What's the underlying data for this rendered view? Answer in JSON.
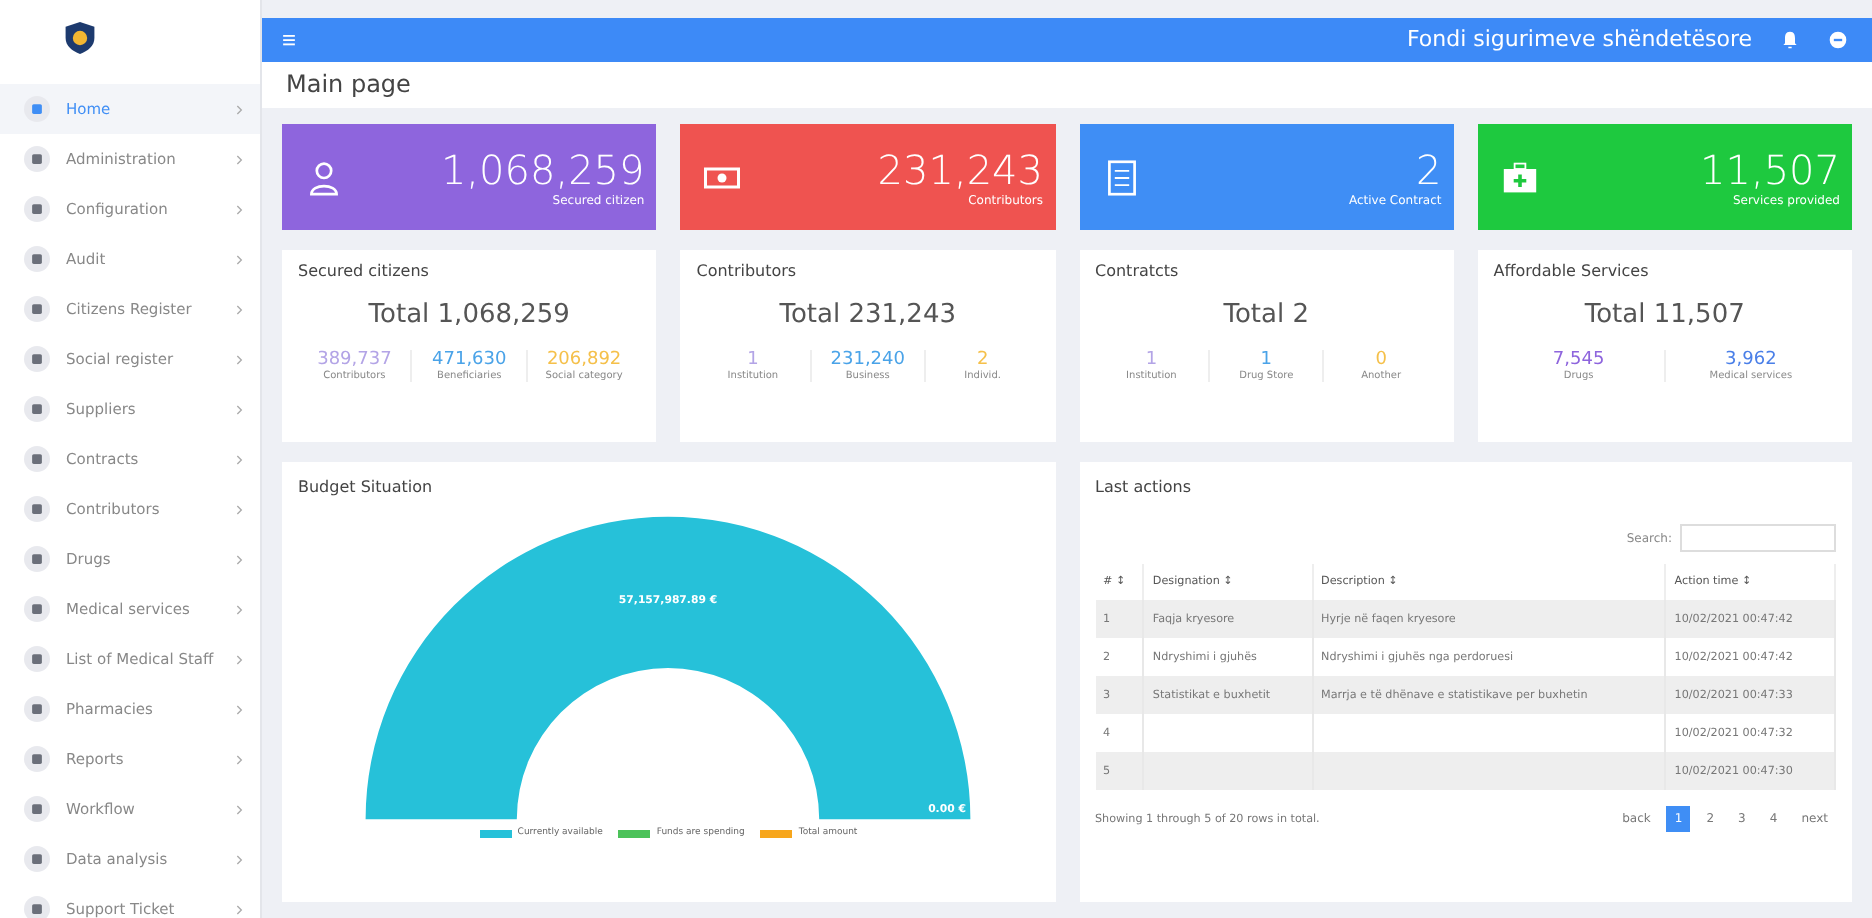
{
  "topbar": {
    "menu_glyph": "≡",
    "title": "Fondi sigurimeve shëndetësore"
  },
  "sidebar": {
    "items": [
      {
        "label": "Home",
        "selected": true
      },
      {
        "label": "Administration",
        "selected": false
      },
      {
        "label": "Configuration",
        "selected": false
      },
      {
        "label": "Audit",
        "selected": false
      },
      {
        "label": "Citizens Register",
        "selected": false
      },
      {
        "label": "Social register",
        "selected": false
      },
      {
        "label": "Suppliers",
        "selected": false
      },
      {
        "label": "Contracts",
        "selected": false
      },
      {
        "label": "Contributors",
        "selected": false
      },
      {
        "label": "Drugs",
        "selected": false
      },
      {
        "label": "Medical services",
        "selected": false
      },
      {
        "label": "List of Medical Staff",
        "selected": false
      },
      {
        "label": "Pharmacies",
        "selected": false
      },
      {
        "label": "Reports",
        "selected": false
      },
      {
        "label": "Workflow",
        "selected": false
      },
      {
        "label": "Data analysis",
        "selected": false
      },
      {
        "label": "Support Ticket",
        "selected": false
      }
    ]
  },
  "page_title": "Main page",
  "summary_cards": [
    {
      "kind": "person",
      "value": "1,068,259",
      "label": "Secured citizen",
      "color": "#8e65dd"
    },
    {
      "kind": "money",
      "value": "231,243",
      "label": "Contributors",
      "color": "#ef5350"
    },
    {
      "kind": "document",
      "value": "2",
      "label": "Active Contract",
      "color": "#3f8ef5"
    },
    {
      "kind": "medkit",
      "value": "11,507",
      "label": "Services provided",
      "color": "#1ec93f"
    }
  ],
  "stat_cards": [
    {
      "title": "Secured citizens",
      "total": "Total 1,068,259",
      "items": [
        {
          "value": "389,737",
          "label": "Contributors",
          "color": "#b3a4e6"
        },
        {
          "value": "471,630",
          "label": "Beneficiaries",
          "color": "#4aa3e8"
        },
        {
          "value": "206,892",
          "label": "Social category",
          "color": "#f5c04a"
        }
      ]
    },
    {
      "title": "Contributors",
      "total": "Total 231,243",
      "items": [
        {
          "value": "1",
          "label": "Institution",
          "color": "#b3a4e6"
        },
        {
          "value": "231,240",
          "label": "Business",
          "color": "#4aa3e8"
        },
        {
          "value": "2",
          "label": "Individ.",
          "color": "#f5c04a"
        }
      ]
    },
    {
      "title": "Contratcts",
      "total": "Total 2",
      "items": [
        {
          "value": "1",
          "label": "Institution",
          "color": "#b3a4e6"
        },
        {
          "value": "1",
          "label": "Drug Store",
          "color": "#4aa3e8"
        },
        {
          "value": "0",
          "label": "Another",
          "color": "#f5c04a"
        }
      ]
    },
    {
      "title": "Affordable Services",
      "total": "Total 11,507",
      "items": [
        {
          "value": "7,545",
          "label": "Drugs",
          "color": "#8e65dd"
        },
        {
          "value": "3,962",
          "label": "Medical services",
          "color": "#4a7fe8"
        }
      ]
    }
  ],
  "budget": {
    "title": "Budget Situation",
    "chart_data": {
      "type": "pie",
      "categories": [
        "Currently available",
        "Funds are spending",
        "Total amount"
      ],
      "series": [
        {
          "values": [
            100,
            0,
            0
          ]
        }
      ],
      "colors": [
        "#26c1d9",
        "#4cc25a",
        "#f7a61c"
      ],
      "value_labels": [
        "57,157,987.89 €",
        "0.00 €"
      ]
    }
  },
  "last_actions": {
    "title": "Last actions",
    "search_label": "Search:",
    "columns": [
      "# ↕",
      "Designation ↕",
      "Description ↕",
      "Action time ↕"
    ],
    "rows": [
      [
        "1",
        "Faqja kryesore",
        "Hyrje në faqen kryesore",
        "10/02/2021 00:47:42"
      ],
      [
        "2",
        "Ndryshimi i gjuhës",
        "Ndryshimi i gjuhës nga perdoruesi",
        "10/02/2021 00:47:42"
      ],
      [
        "3",
        "Statistikat e buxhetit",
        "Marrja e të dhënave e statistikave per buxhetin",
        "10/02/2021 00:47:33"
      ],
      [
        "4",
        "",
        "",
        "10/02/2021 00:47:32"
      ],
      [
        "5",
        "",
        "",
        "10/02/2021 00:47:30"
      ]
    ],
    "footer": "Showing 1 through 5 of 20 rows in total.",
    "pagination": [
      {
        "label": "back",
        "selected": false
      },
      {
        "label": "1",
        "selected": true
      },
      {
        "label": "2",
        "selected": false
      },
      {
        "label": "3",
        "selected": false
      },
      {
        "label": "4",
        "selected": false
      },
      {
        "label": "next",
        "selected": false
      }
    ]
  }
}
